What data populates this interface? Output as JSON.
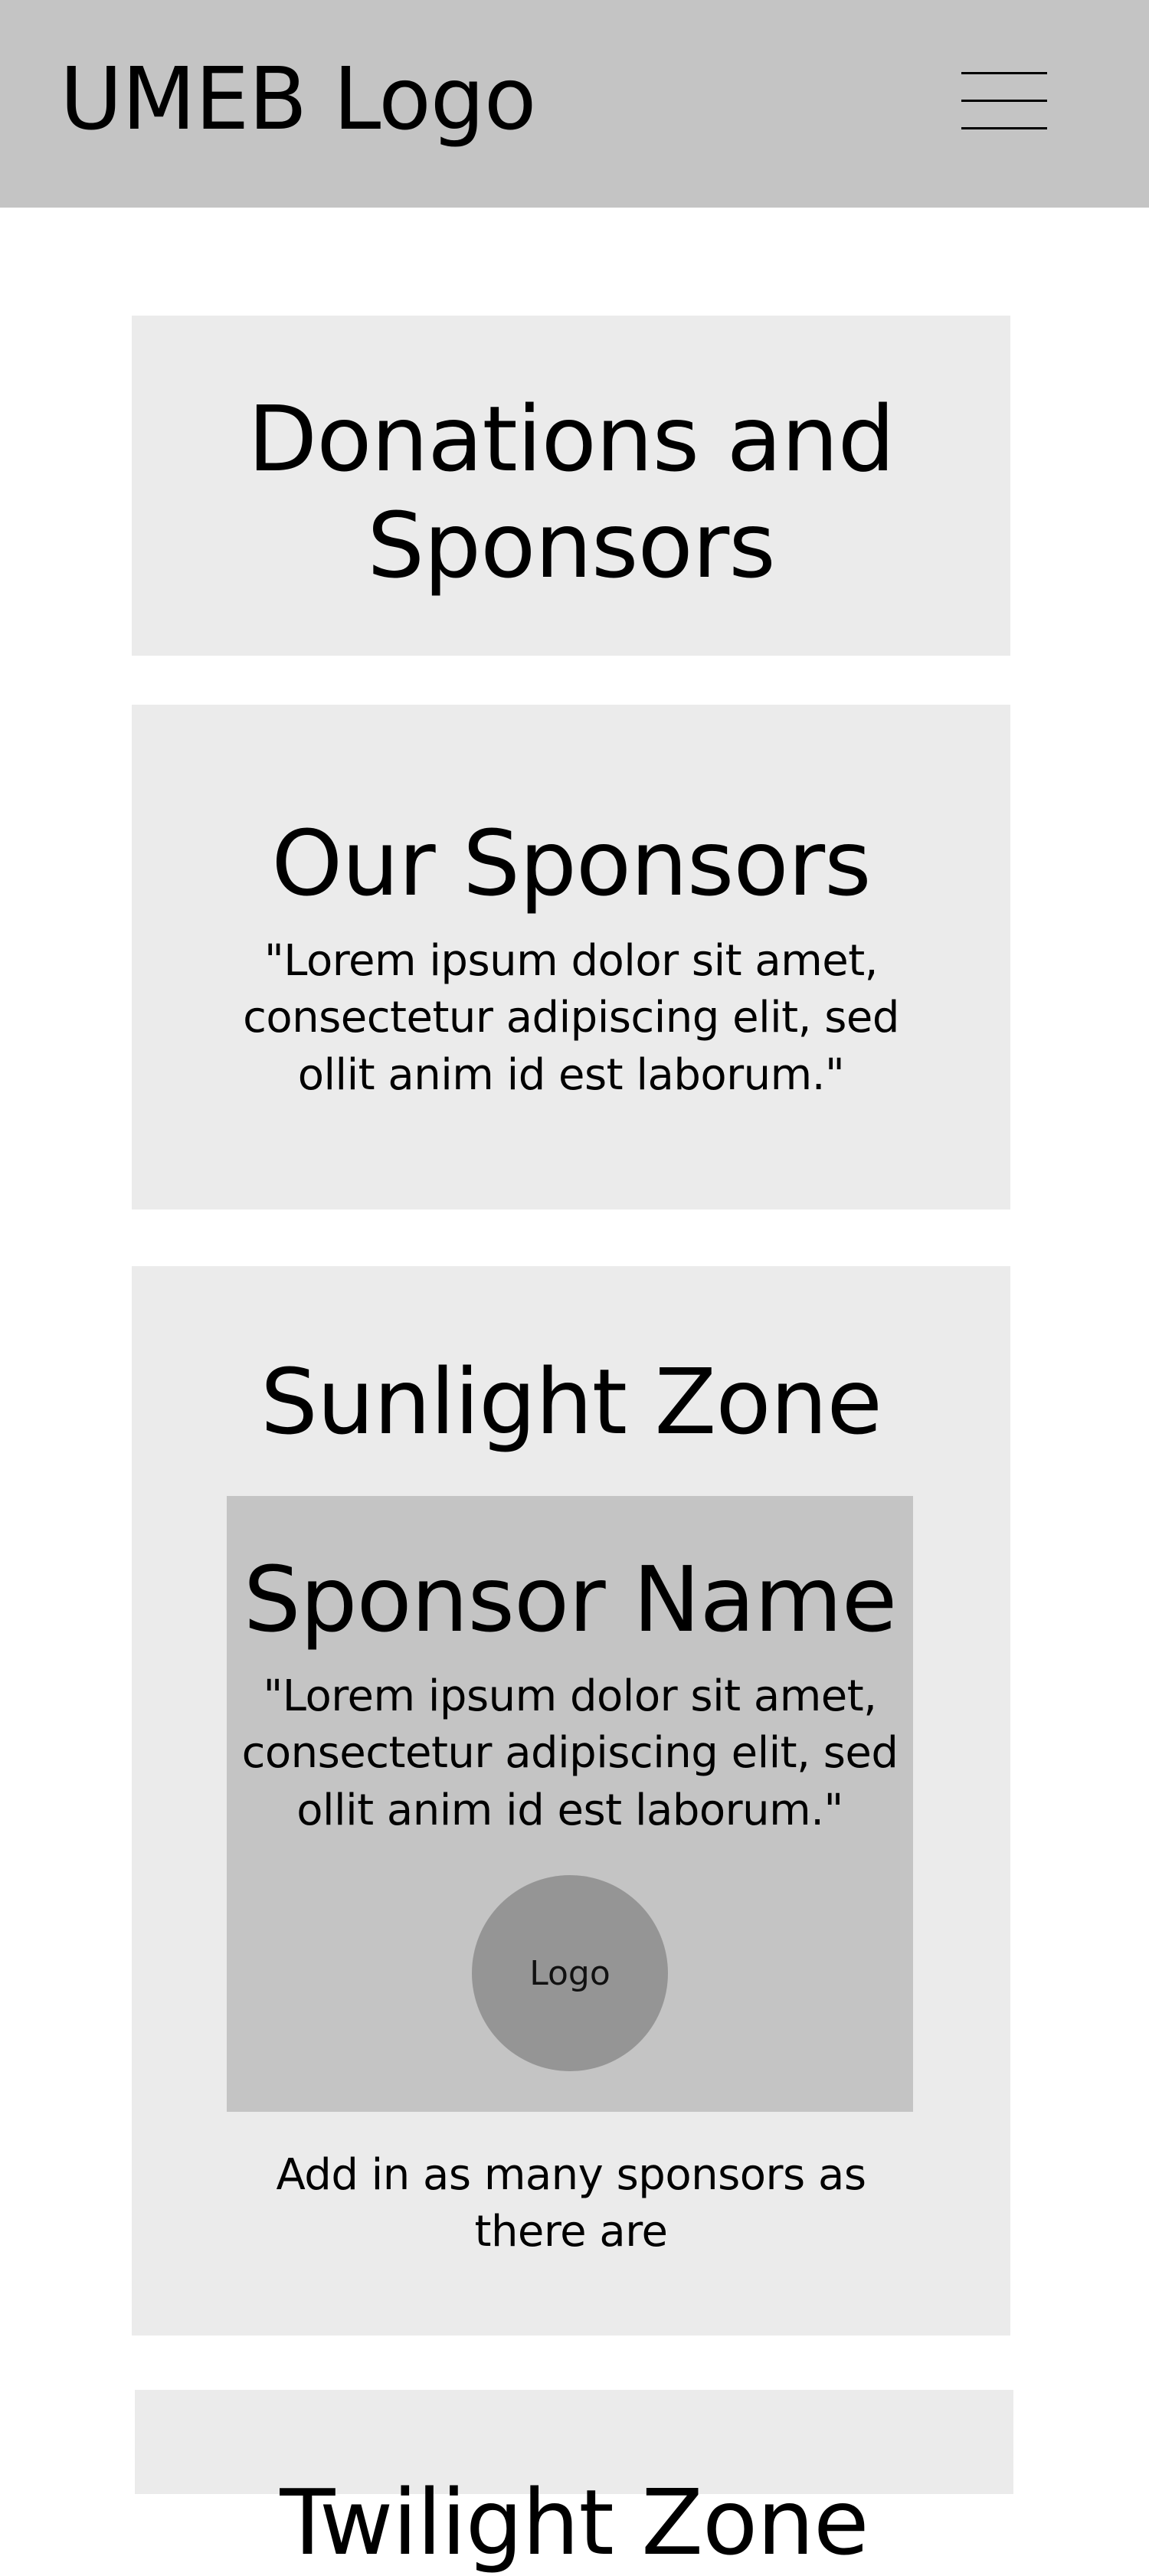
{
  "header": {
    "logo_text": "UMEB Logo",
    "menu_icon": "hamburger-menu-icon"
  },
  "page_title": {
    "line1": "Donations and",
    "line2": "Sponsors"
  },
  "our_sponsors": {
    "title": "Our Sponsors",
    "text_line1": "\"Lorem ipsum dolor sit amet,",
    "text_line2": "consectetur adipiscing elit, sed",
    "text_line3": "ollit anim id est laborum.\""
  },
  "sunlight_zone": {
    "title": "Sunlight Zone",
    "sponsor": {
      "name": "Sponsor Name",
      "text_line1": "\"Lorem ipsum dolor sit amet,",
      "text_line2": "consectetur adipiscing elit, sed",
      "text_line3": "ollit anim id est laborum.\"",
      "logo_label": "Logo"
    },
    "note_line1": "Add in as many sponsors as",
    "note_line2": "there are"
  },
  "twilight_zone": {
    "title": "Twilight Zone"
  },
  "colors": {
    "header_background": "#c4c4c4",
    "card_background": "#ebebeb",
    "sponsor_box_background": "#c4c4c4",
    "logo_circle": "#959595",
    "text": "#000000"
  }
}
